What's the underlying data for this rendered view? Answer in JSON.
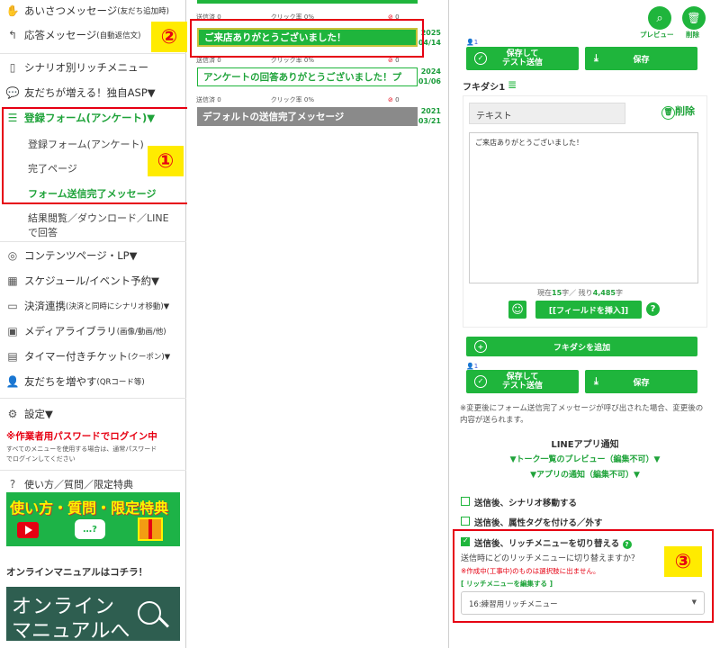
{
  "sidebar": {
    "items": [
      {
        "label": "あいさつメッセージ",
        "sub": "(友だち追加時)",
        "icon": "hand-icon"
      },
      {
        "label": "応答メッセージ",
        "sub": "(自動返信文)",
        "icon": "reply-icon"
      },
      {
        "label": "シナリオ別リッチメニュー",
        "icon": "phone-icon"
      },
      {
        "label": "友だちが増える！独自ASP▼",
        "icon": "chat-icon"
      },
      {
        "label": "登録フォーム(アンケート)▼",
        "icon": "list-icon"
      },
      {
        "label": "コンテンツページ・LP▼",
        "icon": "globe-icon"
      },
      {
        "label": "スケジュール/イベント予約▼",
        "icon": "calendar-icon"
      },
      {
        "label": "決済連携",
        "sub": "(決済と同時にシナリオ移動)▼",
        "icon": "card-icon"
      },
      {
        "label": "メディアライブラリ",
        "sub": "(画像/動画/他)",
        "icon": "image-icon"
      },
      {
        "label": "タイマー付きチケット",
        "sub": "(クーポン)▼",
        "icon": "ticket-icon"
      },
      {
        "label": "友だちを増やす",
        "sub": "(QRコード等)",
        "icon": "add-user-icon"
      },
      {
        "label": "設定▼",
        "icon": "gear-icon"
      }
    ],
    "sub_items": [
      "登録フォーム(アンケート)",
      "完了ページ",
      "フォーム送信完了メッセージ",
      "結果閲覧／ダウンロード／LINE",
      "で回答"
    ],
    "worker_notice": "※作業者用パスワードでログイン中",
    "worker_note_1": "すべてのメニューを使用する場合は、通常パスワード",
    "worker_note_2": "でログインしてください",
    "help_label": "使い方／質問／限定特典",
    "banner1_text": "使い方・質問・限定特典",
    "manual_heading": "オンラインマニュアルはコチラ！",
    "banner2_line1": "オンライン",
    "banner2_line2": "マニュアルへ",
    "badge1": "①",
    "badge2": "②",
    "badge3": "③"
  },
  "messages": [
    {
      "title": "ご来店ありがとうございました！",
      "year": "2025",
      "md": "04/14",
      "sent": "送信済 0",
      "click": "クリック率 0%",
      "sent_top": "送信済 0",
      "click_top": "クリック率 0%"
    },
    {
      "title": "アンケートの回答ありがとうございました！プ",
      "year": "2024",
      "md": "01/06",
      "sent": "送信済 0",
      "click": "クリック率 0%"
    },
    {
      "title": "デフォルトの送信完了メッセージ",
      "year": "2021",
      "md": "03/21",
      "sent": "送信済 0",
      "click": "クリック率 0%"
    }
  ],
  "editor": {
    "preview_label": "プレビュー",
    "delete_label": "削除",
    "save_test_1": "保存して",
    "save_test_2": "テスト送信",
    "save_label": "保存",
    "person_count": "1",
    "fukidashi_label": "フキダシ1",
    "text_type": "テキスト",
    "delete_bubble": "削除",
    "message_body": "ご来店ありがとうございました！",
    "char_prefix": "現在",
    "char_current": "15",
    "char_mid": "字／ 残り",
    "char_remaining": "4,485",
    "char_suffix": "字",
    "insert_field": "[[フィールドを挿入]]",
    "add_bubble": "フキダシを追加",
    "notice": "※変更後にフォーム送信完了メッセージが呼び出された場合、変更後の内容が送られます。",
    "line_app_title": "LINEアプリ通知",
    "talk_preview": "▼トーク一覧のプレビュー（編集不可）▼",
    "app_notify": "▼アプリの通知（編集不可）▼",
    "opt1": "送信後、シナリオ移動する",
    "opt2": "送信後、属性タグを付ける／外す",
    "opt3": "送信後、リッチメニューを切り替える",
    "opt3_q": "送信時にどのリッチメニューに切り替えますか？",
    "opt3_warn": "※作成中(工事中)のものは選択肢に出ません。",
    "opt3_link": "[ リッチメニューを編集する ]",
    "select_value": "16:練習用リッチメニュー"
  },
  "colors": {
    "accent": "#1fb53c",
    "alert": "#e60012",
    "badge": "#ffeb00"
  }
}
